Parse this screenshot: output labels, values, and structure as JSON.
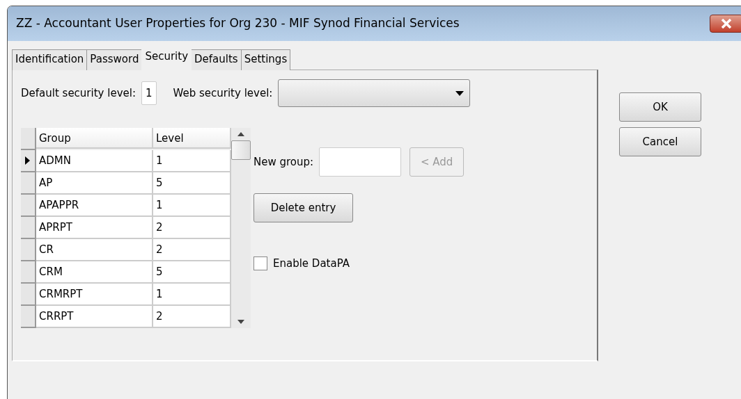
{
  "window": {
    "title": "ZZ - Accountant User Properties for Org 230 - MIF Synod Financial Services"
  },
  "tabs": [
    {
      "label": "Identification",
      "selected": false
    },
    {
      "label": "Password",
      "selected": false
    },
    {
      "label": "Security",
      "selected": true
    },
    {
      "label": "Defaults",
      "selected": false
    },
    {
      "label": "Settings",
      "selected": false
    }
  ],
  "default_security_level": {
    "label": "Default security level:",
    "value": "1"
  },
  "web_security_level": {
    "label": "Web security level:"
  },
  "grid": {
    "columns": [
      "Group",
      "Level"
    ],
    "rows": [
      {
        "group": "ADMN",
        "level": "1",
        "selected": true
      },
      {
        "group": "AP",
        "level": "5",
        "selected": false
      },
      {
        "group": "APAPPR",
        "level": "1",
        "selected": false
      },
      {
        "group": "APRPT",
        "level": "2",
        "selected": false
      },
      {
        "group": "CR",
        "level": "2",
        "selected": false
      },
      {
        "group": "CRM",
        "level": "5",
        "selected": false
      },
      {
        "group": "CRMRPT",
        "level": "1",
        "selected": false
      },
      {
        "group": "CRRPT",
        "level": "2",
        "selected": false
      }
    ]
  },
  "new_group": {
    "label": "New group:"
  },
  "add_button": {
    "label": "< Add",
    "disabled": true
  },
  "delete_button": {
    "label": "Delete entry"
  },
  "enable_datapa": {
    "label": "Enable DataPA",
    "checked": false
  },
  "buttons": [
    "OK",
    "Cancel"
  ]
}
